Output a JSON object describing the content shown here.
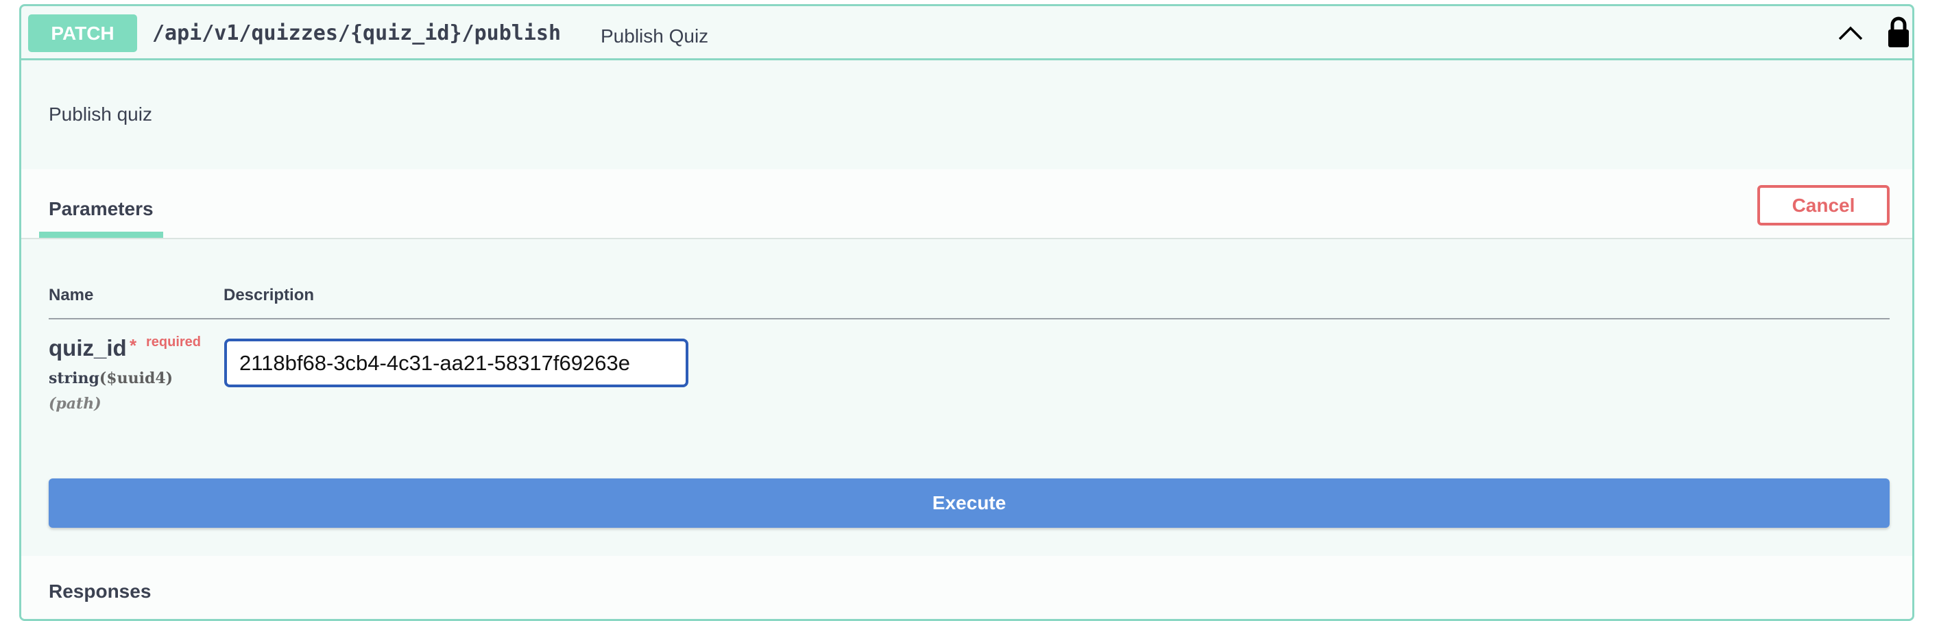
{
  "operation": {
    "method": "PATCH",
    "path": "/api/v1/quizzes/{quiz_id}/publish",
    "summary": "Publish Quiz",
    "description": "Publish quiz",
    "method_color": "#7fdcbf"
  },
  "icons": {
    "collapse": "chevron-up-icon",
    "authorization": "lock-icon"
  },
  "parameters": {
    "tab_label": "Parameters",
    "cancel_label": "Cancel",
    "columns": {
      "name": "Name",
      "description": "Description"
    },
    "items": [
      {
        "name": "quiz_id",
        "required_star": "*",
        "required_label": "required",
        "type": "string",
        "format": "($uuid4)",
        "in": "(path)",
        "value": "2118bf68-3cb4-4c31-aa21-58317f69263e"
      }
    ]
  },
  "execute_label": "Execute",
  "responses_label": "Responses",
  "colors": {
    "accent": "#5a8fdb",
    "cancel": "#e6696b",
    "border": "#8ad7c3",
    "background": "#f3faf8"
  }
}
